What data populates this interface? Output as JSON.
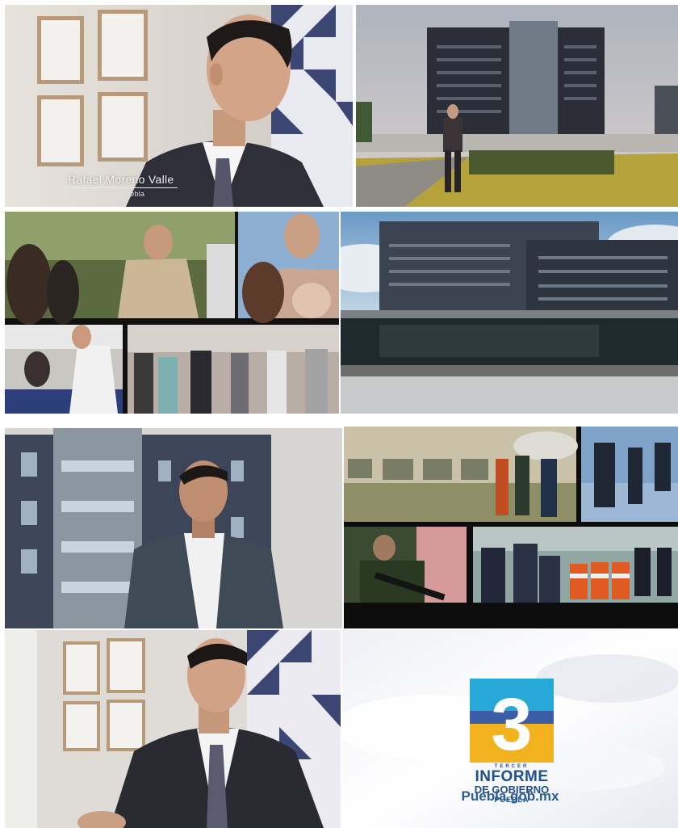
{
  "caption": {
    "name": "Rafael Moreno Valle",
    "role": "Gobernador de Puebla"
  },
  "endcard": {
    "logo_small": "TERCER",
    "logo_title": "INFORME",
    "logo_subtitle": "DE GOBIERNO",
    "logo_state": "PUEBLA",
    "url": "Puebla.gob.mx"
  },
  "colors": {
    "brand_blue": "#1e4f8e",
    "logo_cyan": "#26a9d6",
    "logo_gold": "#f2b21e"
  }
}
